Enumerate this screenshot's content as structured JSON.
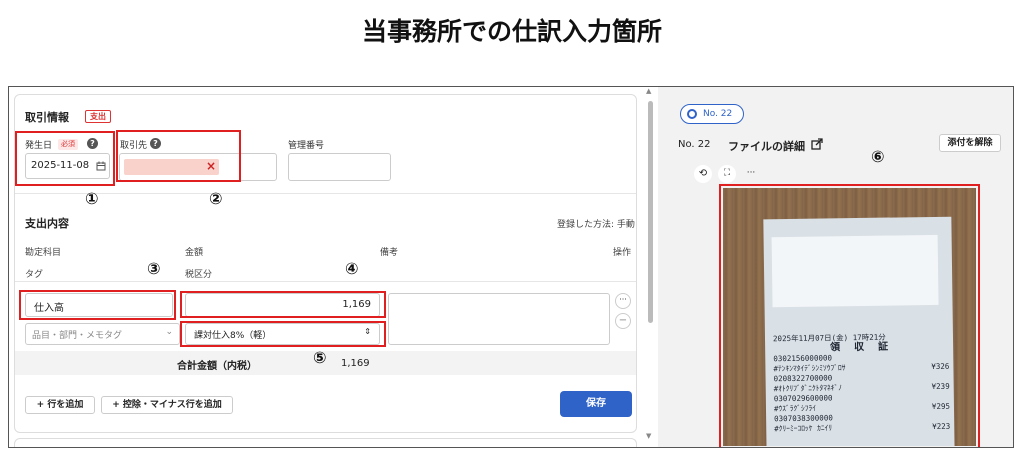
{
  "heading": "当事務所での仕訳入力箇所",
  "transaction": {
    "section_title": "取引情報",
    "type_badge": "支出",
    "date_label": "発生日",
    "required_badge": "必須",
    "date_value": "2025-11-08",
    "partner_label": "取引先",
    "mgmt_label": "管理番号"
  },
  "expense": {
    "section_title": "支出内容",
    "registered_method_label": "登録した方法: 手動",
    "headers": {
      "account": "勘定科目",
      "amount": "金額",
      "memo": "備考",
      "action": "操作",
      "tag": "タグ",
      "tax": "税区分"
    },
    "account_value": "仕入高",
    "amount_value": "1,169",
    "tag_placeholder": "品目・部門・メモタグ",
    "tax_value": "課対仕入8%（軽）",
    "total_label": "合計金額（内税）",
    "total_value": "1,169",
    "add_row_label": "行を追加",
    "add_deduction_label": "控除・マイナス行を追加",
    "save_label": "保存",
    "more_label": "···",
    "minus_label": "−"
  },
  "annotations": {
    "n1": "①",
    "n2": "②",
    "n3": "③",
    "n4": "④",
    "n5": "⑤",
    "n6": "⑥"
  },
  "file_panel": {
    "pill_label": "No. 22",
    "detail_number": "No. 22",
    "detail_title": "ファイルの詳細",
    "detach_label": "添付を解除",
    "more_label": "···"
  },
  "receipt": {
    "datetime": "2025年11月07日(金) 17時21分",
    "title": "領 収 証",
    "lines": [
      {
        "code": "0302156000000",
        "name": "#ﾃﾝｷﾝﾏﾀｲﾃﾞｼﾝﾐｿｳﾌﾞﾛｻ",
        "price": "¥326"
      },
      {
        "code": "0208322700000",
        "name": "#ｵﾄｸﾘﾌﾞﾀﾞﾆｸﾄﾀﾏﾈｷﾞﾉ",
        "price": "¥239"
      },
      {
        "code": "0307029600000",
        "name": "#ｳｽﾞﾗｸﾞｼﾌﾗｲ",
        "price": "¥295"
      },
      {
        "code": "0307038300000",
        "name": "#ｸﾘｰﾐｰｺﾛｯｹ ｶﾆｲﾘ",
        "price": "¥223"
      }
    ]
  }
}
